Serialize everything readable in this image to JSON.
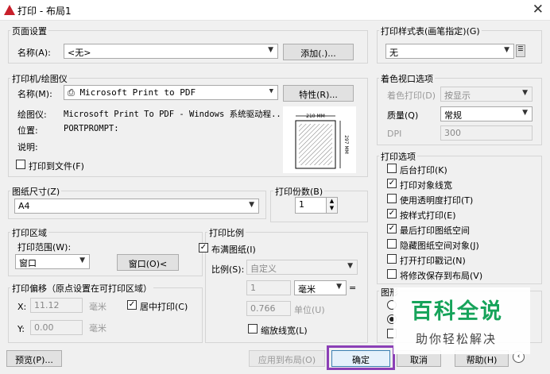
{
  "window": {
    "title": "打印 - 布局1",
    "close_icon": "close-icon"
  },
  "page_setup": {
    "group_label": "页面设置",
    "name_label": "名称(A):",
    "name_value": "<无>",
    "add_button": "添加(.)..."
  },
  "printer": {
    "group_label": "打印机/绘图仪",
    "name_label": "名称(M):",
    "name_value": "Microsoft Print to PDF",
    "properties_button": "特性(R)...",
    "plotter_label": "绘图仪:",
    "plotter_value": "Microsoft Print To PDF - Windows 系统驱动程...",
    "location_label": "位置:",
    "location_value": "PORTPROMPT:",
    "description_label": "说明:",
    "print_to_file_label": "打印到文件(F)",
    "print_to_file_checked": false,
    "preview_width": "210 MM",
    "preview_height": "297 MM"
  },
  "paper_size": {
    "group_label": "图纸尺寸(Z)",
    "value": "A4"
  },
  "copies": {
    "group_label": "打印份数(B)",
    "value": "1"
  },
  "print_area": {
    "group_label": "打印区域",
    "range_label": "打印范围(W):",
    "range_value": "窗口",
    "window_button": "窗口(O)<"
  },
  "offset": {
    "group_label": "打印偏移（原点设置在可打印区域）",
    "x_label": "X:",
    "x_value": "11.12",
    "x_unit": "毫米",
    "y_label": "Y:",
    "y_value": "0.00",
    "y_unit": "毫米",
    "center_label": "居中打印(C)",
    "center_checked": true
  },
  "scale": {
    "group_label": "打印比例",
    "fit_label": "布满图纸(I)",
    "fit_checked": true,
    "scale_label": "比例(S):",
    "scale_value": "自定义",
    "value1": "1",
    "unit1": "毫米",
    "equals": "=",
    "value2": "0.766",
    "unit2": "单位(U)",
    "lineweight_label": "缩放线宽(L)",
    "lineweight_checked": false
  },
  "plot_style": {
    "group_label": "打印样式表(画笔指定)(G)",
    "value": "无"
  },
  "shaded": {
    "group_label": "着色视口选项",
    "shade_label": "着色打印(D)",
    "shade_value": "按显示",
    "quality_label": "质量(Q)",
    "quality_value": "常规",
    "dpi_label": "DPI",
    "dpi_value": "300"
  },
  "options": {
    "group_label": "打印选项",
    "items": [
      {
        "label": "后台打印(K)",
        "checked": false
      },
      {
        "label": "打印对象线宽",
        "checked": true
      },
      {
        "label": "使用透明度打印(T)",
        "checked": false
      },
      {
        "label": "按样式打印(E)",
        "checked": true
      },
      {
        "label": "最后打印图纸空间",
        "checked": true
      },
      {
        "label": "隐藏图纸空间对象(J)",
        "checked": false
      },
      {
        "label": "打开打印戳记(N)",
        "checked": false
      },
      {
        "label": "将修改保存到布局(V)",
        "checked": false
      }
    ]
  },
  "orientation": {
    "group_label": "图形"
  },
  "footer": {
    "preview_button": "预览(P)...",
    "apply_button": "应用到布局(O)",
    "ok_button": "确定",
    "cancel_button": "取消",
    "help_button": "帮助(H)"
  },
  "watermark": {
    "title": "百科全说",
    "subtitle": "助你轻松解决"
  },
  "colors": {
    "highlight": "#8b3fb6",
    "watermark_green": "#16a35a",
    "app_icon": "#c8202b"
  }
}
